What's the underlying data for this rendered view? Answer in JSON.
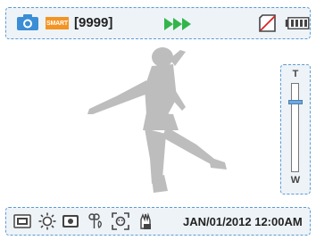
{
  "top_bar": {
    "mode_icon": "camera-icon",
    "smart_badge": "SMART",
    "shots_remaining": "[9999]",
    "play_indicator": "triple-play-icon",
    "storage_icon": "memory-card-icon",
    "battery_icon": "battery-icon"
  },
  "zoom": {
    "tele_label": "T",
    "wide_label": "W",
    "level": 0.2
  },
  "bottom_bar": {
    "icons": [
      "image-size-icon",
      "white-balance-icon",
      "exposure-icon",
      "macro-flower-icon",
      "face-detection-icon",
      "anti-shake-icon"
    ],
    "datetime": "JAN/01/2012 12:00AM"
  },
  "colors": {
    "accent_border": "#5b9bd5",
    "camera_icon": "#3b8ed6",
    "smart_badge": "#f39423",
    "play_arrows": "#33b54a",
    "silhouette": "#bdbdbd"
  }
}
